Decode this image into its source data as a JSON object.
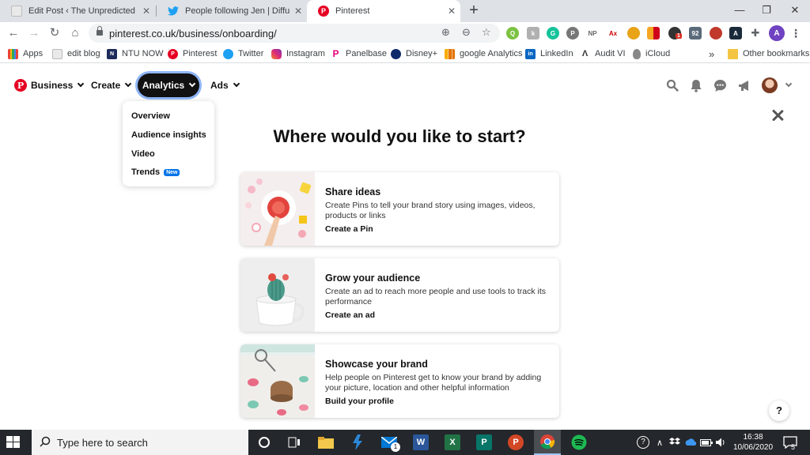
{
  "browser": {
    "tabs": [
      {
        "title": "Edit Post ‹ The Unpredicted page",
        "icon": "wordpress-page-icon"
      },
      {
        "title": "People following Jen | Diffusing t",
        "icon": "twitter-icon"
      },
      {
        "title": "Pinterest",
        "icon": "pinterest-icon",
        "active": true
      }
    ],
    "new_tab": "+",
    "url": "pinterest.co.uk/business/onboarding/",
    "extensions": [
      "Q",
      "k",
      "G",
      "P",
      "NP",
      "Ax",
      "",
      "",
      "1",
      "92",
      "",
      "A",
      "",
      "A"
    ],
    "profile_initial": "A"
  },
  "bookmarks": [
    {
      "label": "Apps",
      "icon": "apps-grid-icon"
    },
    {
      "label": "edit blog",
      "icon": "wordpress-icon"
    },
    {
      "label": "NTU NOW",
      "icon": "ntu-icon"
    },
    {
      "label": "Pinterest",
      "icon": "pinterest-icon"
    },
    {
      "label": "Twitter",
      "icon": "twitter-icon"
    },
    {
      "label": "Instagram",
      "icon": "instagram-icon"
    },
    {
      "label": "Panelbase",
      "icon": "panelbase-icon"
    },
    {
      "label": "Disney+",
      "icon": "disney-icon"
    },
    {
      "label": "google Analytics",
      "icon": "analytics-icon"
    },
    {
      "label": "LinkedIn",
      "icon": "linkedin-icon"
    },
    {
      "label": "Audit VI",
      "icon": "audit-icon"
    },
    {
      "label": "iCloud",
      "icon": "apple-icon"
    },
    {
      "label": "»",
      "icon": "more-icon"
    },
    {
      "label": "Other bookmarks",
      "icon": "folder-icon"
    }
  ],
  "pinterest": {
    "nav": {
      "business": "Business",
      "create": "Create",
      "analytics": "Analytics",
      "ads": "Ads"
    },
    "analytics_menu": {
      "overview": "Overview",
      "audience": "Audience insights",
      "video": "Video",
      "trends": "Trends",
      "trends_badge": "New"
    },
    "heading": "Where would you like to start?",
    "cards": [
      {
        "title": "Share ideas",
        "description": "Create Pins to tell your brand story using images, videos, products or links",
        "link": "Create a Pin"
      },
      {
        "title": "Grow your audience",
        "description": "Create an ad to reach more people and use tools to track its performance",
        "link": "Create an ad"
      },
      {
        "title": "Showcase your brand",
        "description": "Help people on Pinterest get to know your brand by adding your picture, location and other helpful information",
        "link": "Build your profile"
      }
    ],
    "help": "?"
  },
  "taskbar": {
    "search_placeholder": "Type here to search",
    "time": "16:38",
    "date": "10/06/2020",
    "notifications": "5",
    "mail_badge": "1"
  },
  "colors": {
    "pinterest_red": "#e60023",
    "analytics_ring": "#8fb6f7",
    "new_badge": "#0074e8",
    "taskbar": "#24272b"
  }
}
